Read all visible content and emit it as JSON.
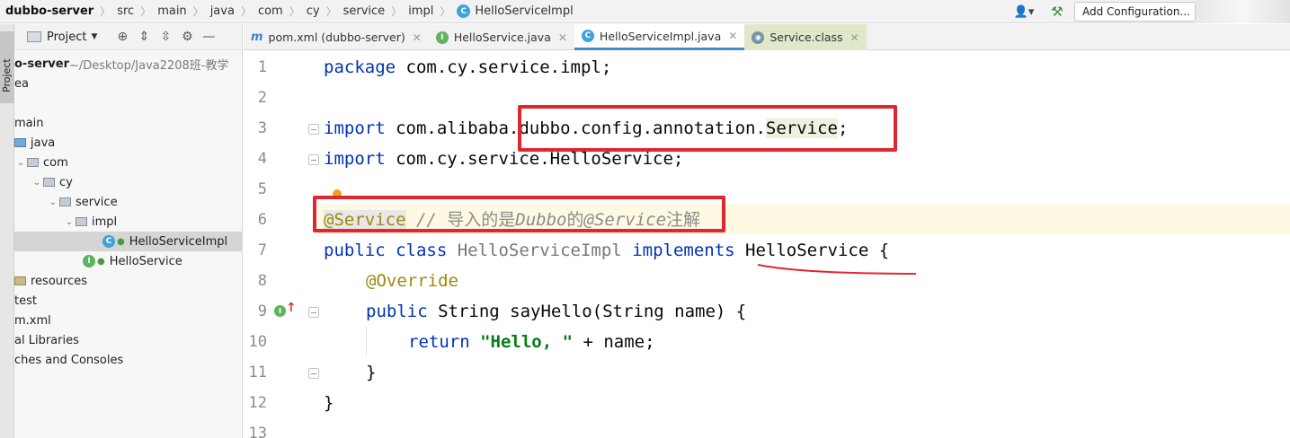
{
  "breadcrumb": [
    "dubbo-server",
    "src",
    "main",
    "java",
    "com",
    "cy",
    "service",
    "impl",
    "HelloServiceImpl"
  ],
  "toolbar": {
    "add_configuration": "Add Configuration..."
  },
  "left_strip": {
    "project_label": "Project"
  },
  "project_panel": {
    "title": "Project",
    "tree": [
      {
        "label": "o-server",
        "suffix": " ~/Desktop/Java2208班-教学"
      },
      {
        "label": "ea"
      },
      {
        "label": ""
      },
      {
        "label": "main"
      },
      {
        "label": "java"
      },
      {
        "label": "com"
      },
      {
        "label": "cy"
      },
      {
        "label": "service"
      },
      {
        "label": "impl"
      },
      {
        "label": "HelloServiceImpl",
        "selected": true
      },
      {
        "label": "HelloService"
      },
      {
        "label": "resources"
      },
      {
        "label": "test"
      },
      {
        "label": "m.xml"
      },
      {
        "label": "al Libraries"
      },
      {
        "label": "ches and Consoles"
      }
    ]
  },
  "tabs": [
    {
      "label": "pom.xml (dubbo-server)",
      "icon": "maven-icon"
    },
    {
      "label": "HelloService.java",
      "icon": "interface-icon"
    },
    {
      "label": "HelloServiceImpl.java",
      "icon": "class-icon",
      "active": true
    },
    {
      "label": "Service.class",
      "icon": "compiled-class-icon"
    }
  ],
  "editor": {
    "line_numbers": [
      "1",
      "2",
      "3",
      "4",
      "5",
      "6",
      "7",
      "8",
      "9",
      "10",
      "11",
      "12",
      "13"
    ],
    "code": {
      "pkg_kw": "package",
      "pkg_name": " com.cy.service.impl;",
      "imp1_kw": "import",
      "imp1_a": " com.alibaba.dubbo.config.annotation.",
      "imp1_b": "Service",
      "imp1_c": ";",
      "imp2_kw": "import",
      "imp2_a": " com.cy.service.HelloService;",
      "l6_ann": "@Service",
      "l6_cmt_a": " // ",
      "l6_cmt_b": "导入的是",
      "l6_cmt_c": "Dubbo",
      "l6_cmt_d": "的",
      "l6_cmt_e": "@Service",
      "l6_cmt_f": "注解",
      "l7_kw1": "public class",
      "l7_name": " HelloServiceImpl ",
      "l7_kw2": "implements",
      "l7_rest": " HelloService {",
      "l8_ann": "@Override",
      "l9_kw": "public",
      "l9_rest": " String sayHello(String name) {",
      "l10_kw": "return",
      "l10_str": "\"Hello, \"",
      "l10_rest": " + name;",
      "l11": "}",
      "l12": "}"
    }
  }
}
